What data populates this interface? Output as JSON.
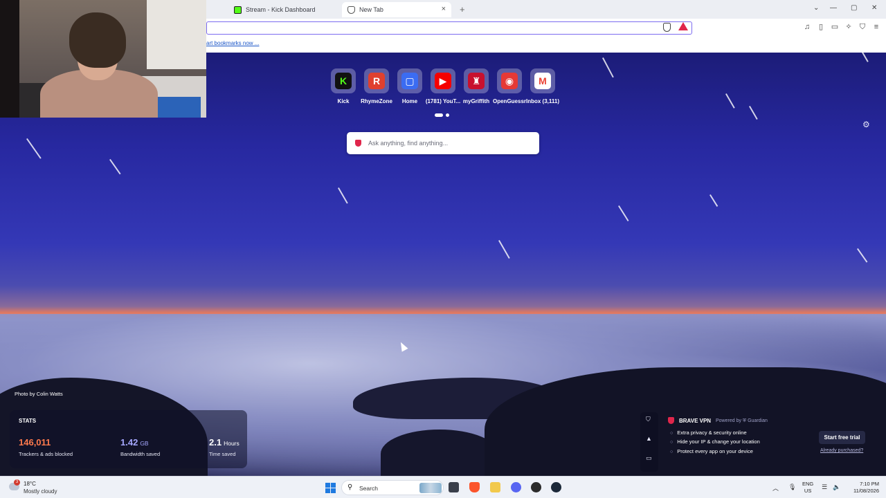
{
  "tabs": [
    {
      "label": "Stream - Kick Dashboard",
      "active": false,
      "favicon": "kick-icon"
    },
    {
      "label": "New Tab",
      "active": true,
      "favicon": "brave-icon"
    }
  ],
  "tab_close_glyph": "×",
  "new_tab_glyph": "+",
  "window_controls": {
    "dropdown": "⌄",
    "minimize": "—",
    "maximize": "▢",
    "close": "✕"
  },
  "bookmarks_bar": {
    "link_text": "art bookmarks now ..."
  },
  "top_sites": [
    {
      "label": "Kick",
      "icon": "kick-icon",
      "color": "#53fc18",
      "glyph": "K"
    },
    {
      "label": "RhymeZone",
      "icon": "rhymezone-icon",
      "color": "#e0402e",
      "glyph": "R"
    },
    {
      "label": "Home",
      "icon": "roblox-icon",
      "color": "#3b6cf2",
      "glyph": "▢"
    },
    {
      "label": "(1781) YouT...",
      "icon": "youtube-icon",
      "color": "#f50000",
      "glyph": "▶"
    },
    {
      "label": "myGriffith",
      "icon": "griffith-icon",
      "color": "#c8102e",
      "glyph": "♜"
    },
    {
      "label": "OpenGuessr",
      "icon": "openguessr-icon",
      "color": "#e53935",
      "glyph": "◉"
    },
    {
      "label": "Inbox (3,111)",
      "icon": "gmail-icon",
      "color": "#ea4335",
      "glyph": "M"
    }
  ],
  "search": {
    "placeholder": "Ask anything, find anything..."
  },
  "settings_glyph": "⚙",
  "photo_credit": "Photo by Colin Watts",
  "stats": {
    "heading": "STATS",
    "trackers": {
      "value": "146,011",
      "unit": "",
      "desc": "Trackers & ads blocked",
      "color": "#ff7a4d"
    },
    "bandwidth": {
      "value": "1.42",
      "unit": "GB",
      "desc": "Bandwidth saved",
      "color": "#a6a8ff"
    },
    "time": {
      "value": "2.1",
      "unit": "Hours",
      "desc": "Time saved",
      "color": "#ffffff"
    }
  },
  "vpn": {
    "title": "BRAVE VPN",
    "powered": "Powered by ⛨ Guardian",
    "features": [
      "Extra privacy & security online",
      "Hide your IP & change your location",
      "Protect every app on your device"
    ],
    "cta": "Start free trial",
    "secondary": "Already purchased?",
    "rail_icons": [
      "shield-icon",
      "rewards-icon",
      "wallet-icon"
    ]
  },
  "taskbar": {
    "weather_badge": "3",
    "temperature": "18°C",
    "condition": "Mostly cloudy",
    "search_label": "Search",
    "lang_top": "ENG",
    "lang_bottom": "US",
    "time": "7:10 PM",
    "date": "11/08/2026",
    "tray_chevron": "︿",
    "tray_mic": "🎙",
    "tray_wifi": "☰",
    "tray_volume": "🔈"
  }
}
